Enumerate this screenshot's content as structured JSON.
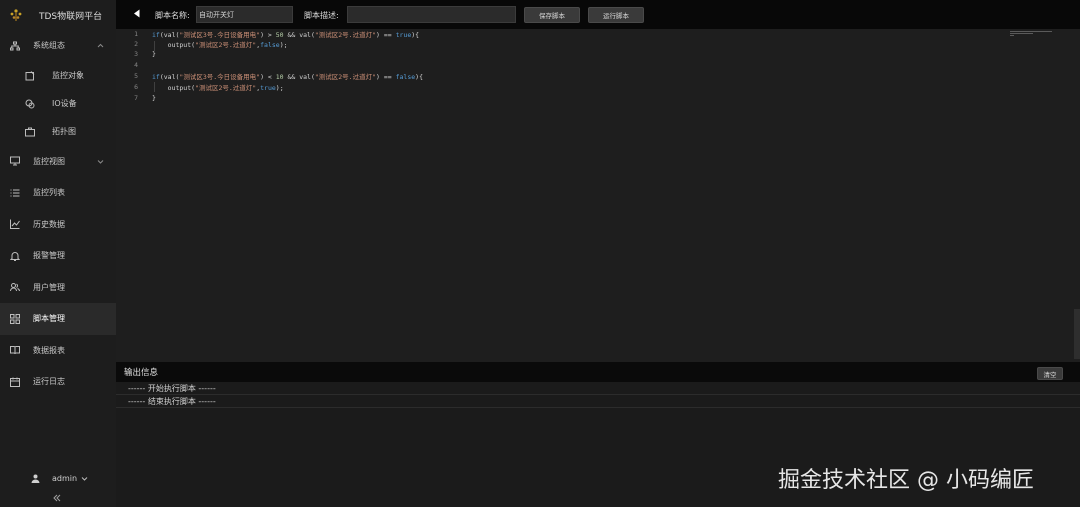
{
  "app": {
    "title": "TDS物联网平台"
  },
  "sidebar": {
    "items": [
      {
        "label": "系统组态",
        "icon": "sitemap-icon",
        "expanded": true
      },
      {
        "label": "监控对象",
        "icon": "object-icon",
        "sub": true
      },
      {
        "label": "IO设备",
        "icon": "device-icon",
        "sub": true
      },
      {
        "label": "拓扑图",
        "icon": "topology-icon",
        "sub": true
      },
      {
        "label": "监控视图",
        "icon": "monitor-icon",
        "expanded": false
      },
      {
        "label": "监控列表",
        "icon": "list-icon"
      },
      {
        "label": "历史数据",
        "icon": "chart-line-icon"
      },
      {
        "label": "报警管理",
        "icon": "bell-icon"
      },
      {
        "label": "用户管理",
        "icon": "users-icon"
      },
      {
        "label": "脚本管理",
        "icon": "grid-icon",
        "active": true
      },
      {
        "label": "数据报表",
        "icon": "book-icon"
      },
      {
        "label": "运行日志",
        "icon": "calendar-icon"
      }
    ],
    "user": "admin"
  },
  "toolbar": {
    "script_name_label": "脚本名称:",
    "script_name_value": "自动开关灯",
    "script_desc_label": "脚本描述:",
    "script_desc_value": "",
    "save_label": "保存脚本",
    "run_label": "运行脚本"
  },
  "editor": {
    "line_numbers": [
      "1",
      "2",
      "3",
      "4",
      "5",
      "6",
      "7"
    ],
    "lines": [
      "if(val(\"测试区3号.今日设备用电\") > 50 && val(\"测试区2号.过道灯\") == true){",
      "    output(\"测试区2号.过道灯\",false);",
      "}",
      "",
      "if(val(\"测试区3号.今日设备用电\") < 10 && val(\"测试区2号.过道灯\") == false){",
      "    output(\"测试区2号.过道灯\",true);",
      "}"
    ]
  },
  "output": {
    "title": "输出信息",
    "clear_label": "清空",
    "lines": [
      "------ 开始执行脚本 ------",
      "------ 结束执行脚本 ------"
    ]
  },
  "watermark": "掘金技术社区 @ 小码编匠",
  "colors": {
    "keyword": "#569cd6",
    "string": "#ce9178",
    "number": "#b5cea8",
    "background": "#1e1e1e"
  }
}
